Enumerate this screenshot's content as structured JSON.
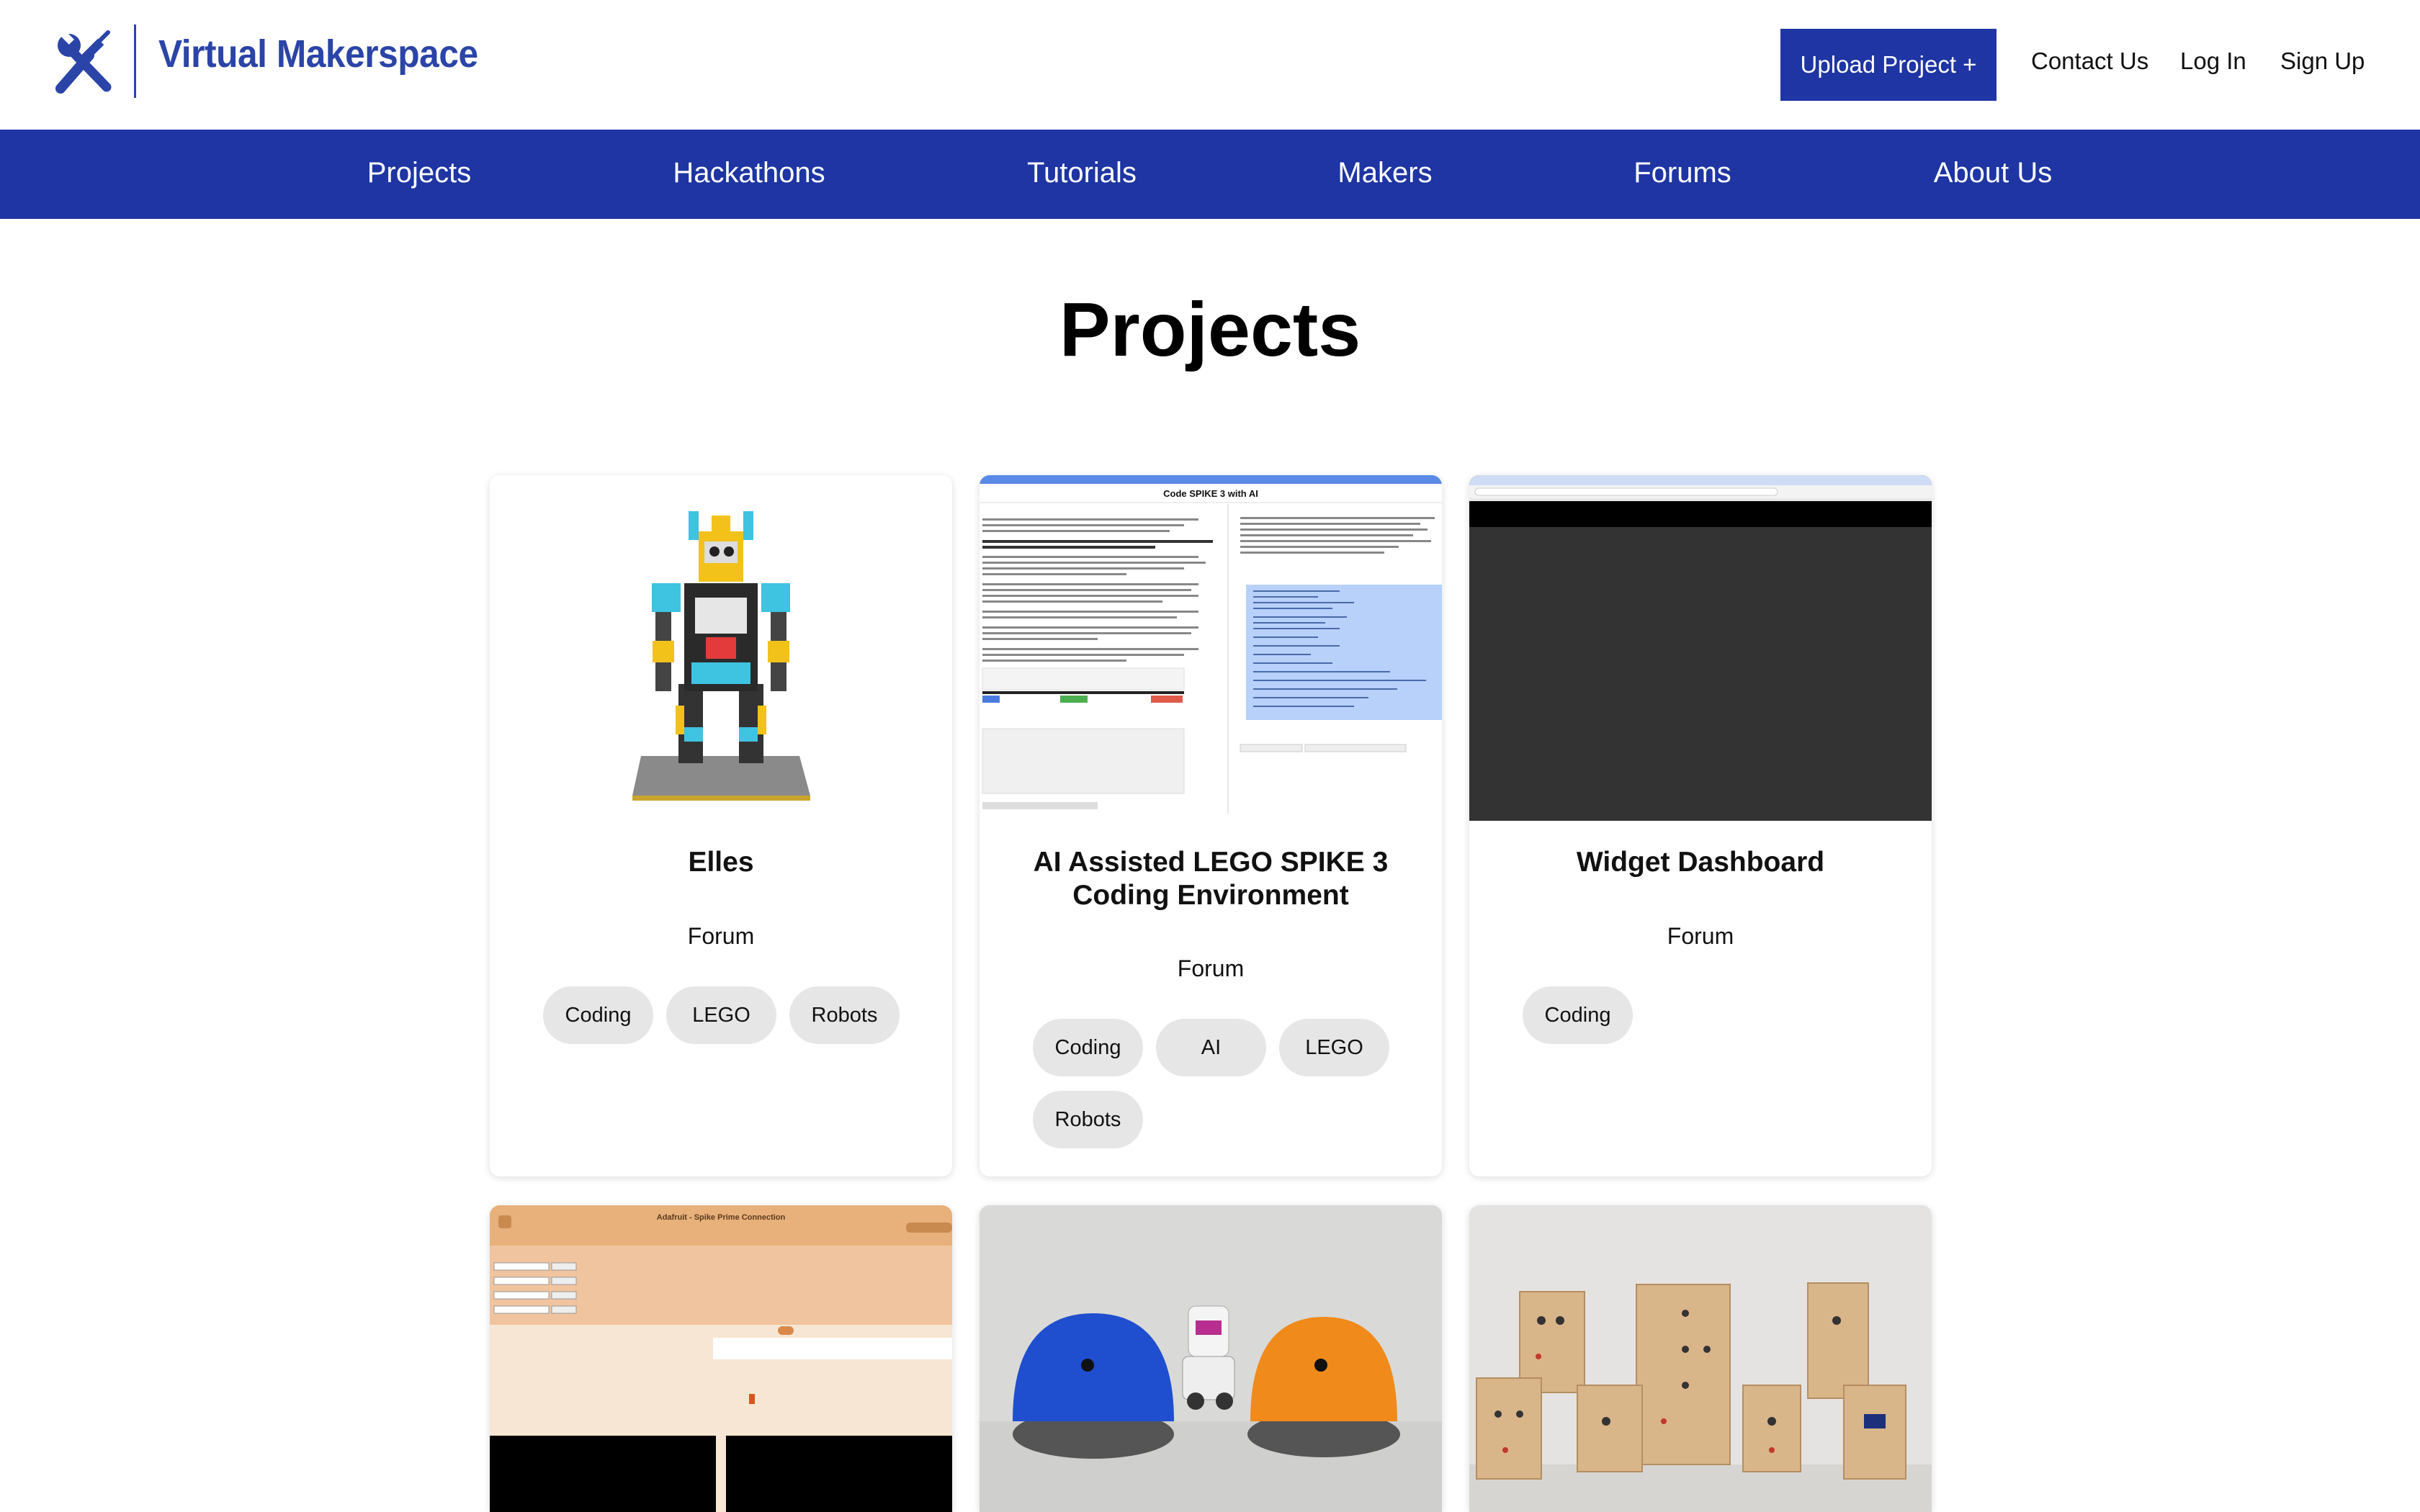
{
  "header": {
    "brand": "Virtual Makerspace",
    "upload_label": "Upload Project +",
    "contact_label": "Contact Us",
    "login_label": "Log In",
    "signup_label": "Sign Up"
  },
  "nav": {
    "items": [
      "Projects",
      "Hackathons",
      "Tutorials",
      "Makers",
      "Forums",
      "About Us"
    ]
  },
  "page": {
    "title": "Projects"
  },
  "projects": [
    {
      "title": "Elles",
      "type": "Forum",
      "tags": [
        "Coding",
        "LEGO",
        "Robots"
      ]
    },
    {
      "title": "AI Assisted LEGO SPIKE 3 Coding Environment",
      "type": "Forum",
      "tags": [
        "Coding",
        "AI",
        "LEGO",
        "Robots"
      ],
      "screenshot_header": "Code SPIKE 3 with AI"
    },
    {
      "title": "Widget Dashboard",
      "type": "Forum",
      "tags": [
        "Coding"
      ]
    },
    {
      "screenshot_header": "Adafruit - Spike Prime Connection"
    },
    {},
    {}
  ],
  "colors": {
    "brand_blue": "#1e35a3",
    "logo_blue": "#2b44a8",
    "tag_bg": "#e6e6e6"
  }
}
